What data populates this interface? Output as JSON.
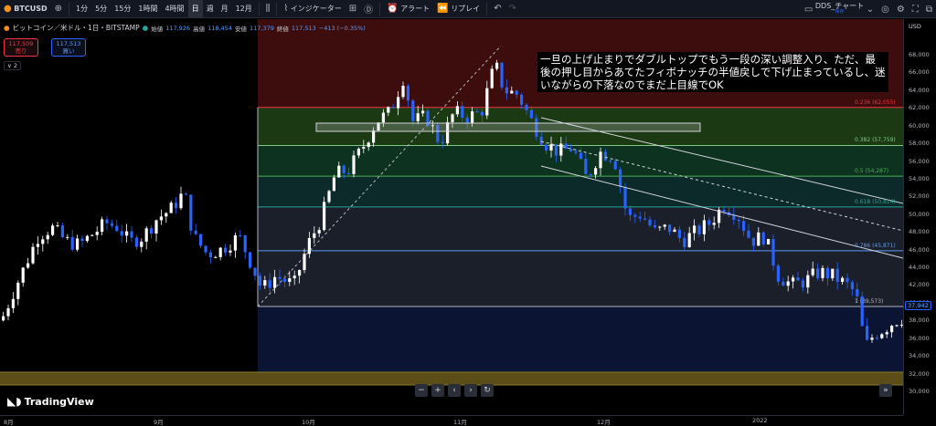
{
  "toolbar": {
    "symbol": "BTCUSD",
    "intervals": [
      "1分",
      "5分",
      "15分",
      "1時間",
      "4時間",
      "日",
      "週",
      "月",
      "12月"
    ],
    "selected_interval": "日",
    "indicators_label": "インジケーター",
    "alert_label": "アラート",
    "replay_label": "リプレイ",
    "layout_name": "DDS_チャート",
    "layout_sub": "保存"
  },
  "legend": {
    "title": "ビットコイン／米ドル・1日・BITSTAMP",
    "open_label": "始値",
    "open": "117,926",
    "high_label": "高値",
    "high": "118,454",
    "low_label": "安値",
    "low": "117,379",
    "close_label": "終値",
    "close": "117,513",
    "change": "−413 (−0.35%)"
  },
  "trade": {
    "sell_price": "117,509",
    "sell_label": "売り",
    "buy_price": "117,513",
    "buy_label": "買い",
    "collapse": "∨ 2"
  },
  "note": "一旦の上げ止まりでダブルトップでもう一段の深い調整入り、ただ、最後の押し目からあてたフィボナッチの半値戻しで下げ止まっているし、迷いながらの下落なのでまだ上目線でOK",
  "fib_levels": [
    {
      "label": "0.236 (62,055)",
      "price": 62055,
      "color": "#f23645",
      "fill": "#3a1212"
    },
    {
      "label": "0.382 (57,759)",
      "price": 57759,
      "color": "#81c784",
      "fill": "#1b3a14"
    },
    {
      "label": "0.5 (54,287)",
      "price": 54287,
      "color": "#4caf50",
      "fill": "#0d3320"
    },
    {
      "label": "0.618 (50,814)",
      "price": 50814,
      "color": "#26a69a",
      "fill": "#0c2a2a"
    },
    {
      "label": "0.786 (45,871)",
      "price": 45871,
      "color": "#5b9cf6",
      "fill": "#1b1f2a"
    },
    {
      "label": "1 (39,573)",
      "price": 39573,
      "color": "#b2b5be",
      "fill": "#1b1f2a"
    }
  ],
  "price_axis": {
    "currency": "USD",
    "ticks": [
      "68,000",
      "66,000",
      "64,000",
      "62,000",
      "60,000",
      "58,000",
      "56,000",
      "54,000",
      "52,000",
      "50,000",
      "48,000",
      "46,000",
      "44,000",
      "42,000",
      "40,000",
      "38,000",
      "36,000",
      "34,000",
      "32,000",
      "30,000"
    ],
    "current_price": "37,942"
  },
  "time_axis": {
    "labels": [
      "8月",
      "9月",
      "10月",
      "11月",
      "12月",
      "2022"
    ]
  },
  "branding": "TradingView",
  "chart_data": {
    "type": "candlestick",
    "title": "ビットコイン／米ドル・1日・BITSTAMP",
    "ylim": [
      29000,
      69000
    ],
    "y_unit": "USD",
    "up_color": "#ffffff",
    "down_color": "#2962ff"
  }
}
